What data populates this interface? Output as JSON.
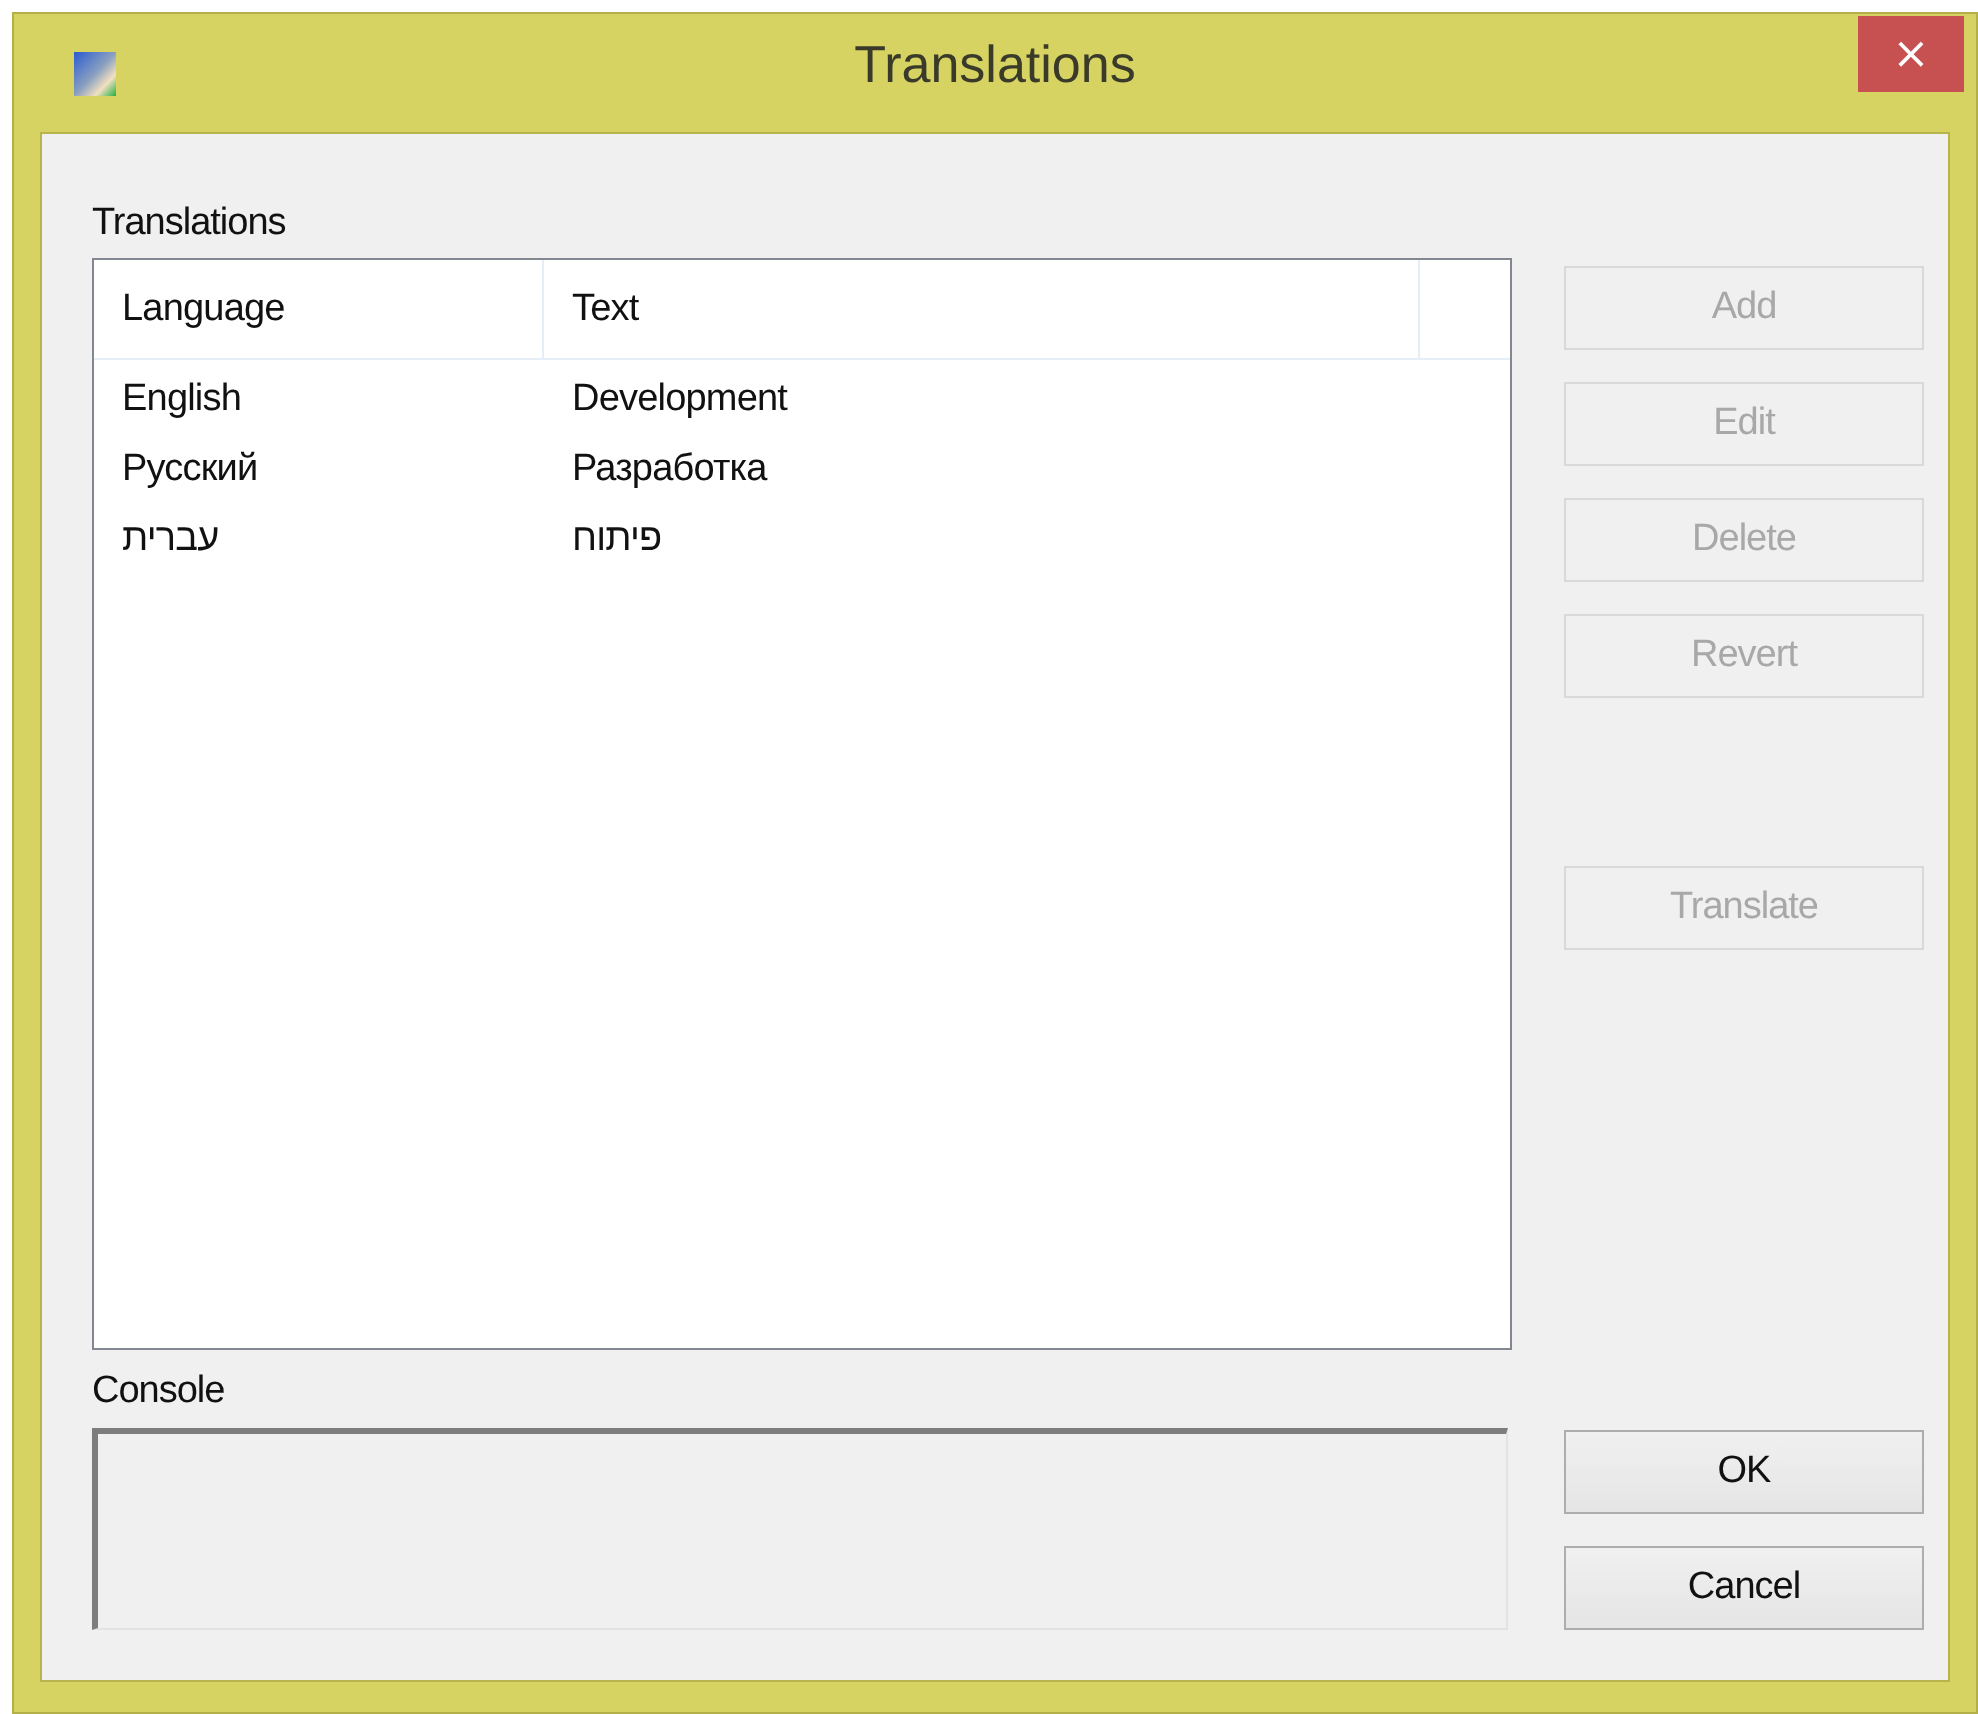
{
  "window": {
    "title": "Translations",
    "close": "×"
  },
  "list_label": "Translations",
  "table": {
    "columns": [
      "Language",
      "Text"
    ],
    "rows": [
      {
        "language": "English",
        "text": "Development"
      },
      {
        "language": "Русский",
        "text": "Разработка"
      },
      {
        "language": "עברית",
        "text": "פיתוח"
      }
    ]
  },
  "edit_buttons": [
    {
      "label": "Add",
      "disabled": true
    },
    {
      "label": "Edit",
      "disabled": true
    },
    {
      "label": "Delete",
      "disabled": true
    },
    {
      "label": "Revert",
      "disabled": true
    }
  ],
  "tool_buttons": [
    {
      "label": "Translate",
      "disabled": true
    }
  ],
  "console_label": "Console",
  "dialog_buttons": [
    {
      "label": "OK",
      "disabled": false
    },
    {
      "label": "Cancel",
      "disabled": false
    }
  ]
}
